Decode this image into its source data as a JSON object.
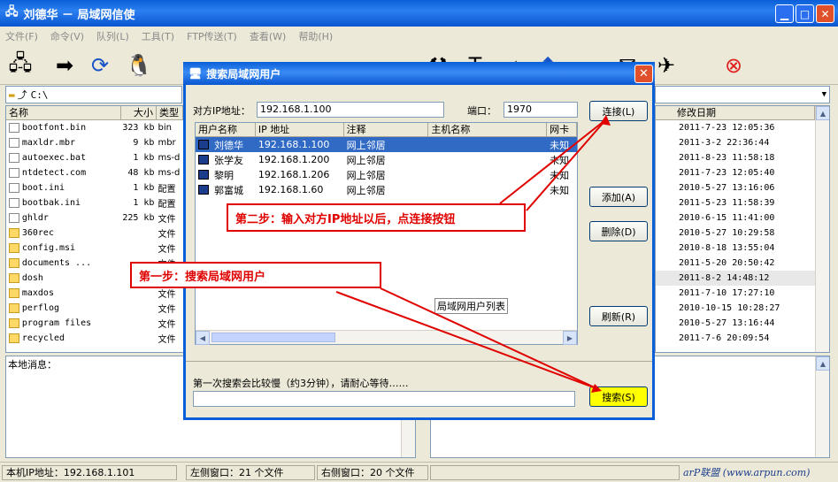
{
  "window": {
    "title": "刘德华 － 局域网信使"
  },
  "menu": [
    "文件(F)",
    "命令(V)",
    "队列(L)",
    "工具(T)",
    "FTP传送(T)",
    "查看(W)",
    "帮助(H)"
  ],
  "left_path": "C:\\",
  "left_headers": [
    "名称",
    "大小",
    "类型"
  ],
  "left_files": [
    {
      "name": "bootfont.bin",
      "size": "323 kb",
      "type": "bin"
    },
    {
      "name": "maxldr.mbr",
      "size": "9 kb",
      "type": "mbr"
    },
    {
      "name": "autoexec.bat",
      "size": "1 kb",
      "type": "ms-d"
    },
    {
      "name": "ntdetect.com",
      "size": "48 kb",
      "type": "ms-d"
    },
    {
      "name": "boot.ini",
      "size": "1 kb",
      "type": "配置"
    },
    {
      "name": "bootbak.ini",
      "size": "1 kb",
      "type": "配置"
    },
    {
      "name": "ghldr",
      "size": "225 kb",
      "type": "文件"
    },
    {
      "name": "360rec",
      "size": "",
      "type": "文件"
    },
    {
      "name": "config.msi",
      "size": "",
      "type": "文件"
    },
    {
      "name": "documents ...",
      "size": "",
      "type": "文件"
    },
    {
      "name": "dosh",
      "size": "",
      "type": "文件"
    },
    {
      "name": "maxdos",
      "size": "",
      "type": "文件"
    },
    {
      "name": "perflog",
      "size": "",
      "type": "文件"
    },
    {
      "name": "program files",
      "size": "",
      "type": "文件"
    },
    {
      "name": "recycled",
      "size": "",
      "type": "文件"
    }
  ],
  "right_header": "修改日期",
  "right_dates": [
    "2011-7-23 12:05:36",
    "2011-3-2 22:36:44",
    "2011-8-23 11:58:18",
    "2011-7-23 12:05:40",
    "2010-5-27 13:16:06",
    "2011-5-23 11:58:39",
    "2010-6-15 11:41:00",
    "2010-5-27 10:29:58",
    "2010-8-18 13:55:04",
    "2011-5-20 20:50:42",
    "2011-8-2 14:48:12",
    "2011-7-10 17:27:10",
    "2010-10-15 10:28:27",
    "2010-5-27 13:16:44",
    "2011-7-6 20:09:54"
  ],
  "local_message_label": "本地消息：",
  "status": {
    "ip": "本机IP地址：192.168.1.101",
    "left": "左侧窗口：21 个文件",
    "right": "右侧窗口：20 个文件",
    "watermark": "arP联盟 (www.arpun.com)"
  },
  "dialog": {
    "title": "搜索局域网用户",
    "ip_label": "对方IP地址：",
    "ip_value": "192.168.1.100",
    "port_label": "端口：",
    "port_value": "1970",
    "connect": "连接(L)",
    "add": "添加(A)",
    "delete": "删除(D)",
    "refresh": "刷新(R)",
    "search": "搜索(S)",
    "headers": [
      "用户名称",
      "IP 地址",
      "注释",
      "主机名称",
      "网卡"
    ],
    "users": [
      {
        "name": "刘德华",
        "ip": "192.168.1.100",
        "note": "网上邻居",
        "host": "",
        "nic": "未知"
      },
      {
        "name": "张学友",
        "ip": "192.168.1.200",
        "note": "网上邻居",
        "host": "",
        "nic": "未知"
      },
      {
        "name": "黎明",
        "ip": "192.168.1.206",
        "note": "网上邻居",
        "host": "",
        "nic": "未知"
      },
      {
        "name": "郭富城",
        "ip": "192.168.1.60",
        "note": "网上邻居",
        "host": "",
        "nic": "未知"
      }
    ],
    "list_caption": "局域网用户列表",
    "hint": "第一次搜索会比较慢（约3分钟），请耐心等待……"
  },
  "callouts": {
    "step1": "第一步：搜索局域网用户",
    "step2": "第二步：输入对方IP地址以后，点连接按钮"
  }
}
